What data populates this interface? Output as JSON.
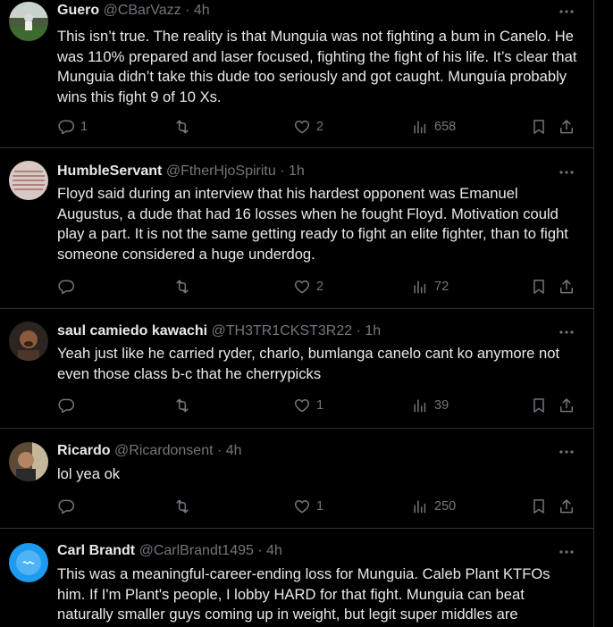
{
  "tweets": [
    {
      "name": "Guero",
      "handle": "@CBarVazz",
      "time": "4h",
      "text": "This isn’t true. The reality is that Munguia was not fighting a bum in Canelo. He was 110% prepared and laser focused, fighting the fight of his life. It’s clear that Munguia didn’t take this dude too seriously and got caught. Munguía probably wins this fight 9 of 10 Xs.",
      "replies": "1",
      "reposts": "",
      "likes": "2",
      "views": "658"
    },
    {
      "name": "HumbleServant",
      "handle": "@FtherHjoSpiritu",
      "time": "1h",
      "text": "Floyd said during an interview that his hardest opponent was Emanuel Augustus, a dude that had 16 losses when he fought Floyd. Motivation could play a part. It is not the same getting ready to fight an elite fighter, than to fight someone considered a huge underdog.",
      "replies": "",
      "reposts": "",
      "likes": "2",
      "views": "72"
    },
    {
      "name": "saul camiedo kawachi",
      "handle": "@TH3TR1CKST3R22",
      "time": "1h",
      "text": "Yeah just like he carried ryder, charlo, bumlanga canelo cant ko anymore not even those class b-c that he cherrypicks",
      "replies": "",
      "reposts": "",
      "likes": "1",
      "views": "39"
    },
    {
      "name": "Ricardo",
      "handle": "@Ricardonsent",
      "time": "4h",
      "text": "lol yea ok",
      "replies": "",
      "reposts": "",
      "likes": "1",
      "views": "250"
    },
    {
      "name": "Carl Brandt",
      "handle": "@CarlBrandt1495",
      "time": "4h",
      "text": "This was a meaningful-career-ending loss for Munguia. Caleb Plant KTFOs him. If I'm Plant's people, I lobby HARD for that fight. Munguia can beat naturally smaller guys coming up in weight, but legit super middles are",
      "replies": "",
      "reposts": "",
      "likes": "",
      "views": ""
    }
  ],
  "separator": "·",
  "icons": [
    "more-icon",
    "reply-icon",
    "repost-icon",
    "like-icon",
    "views-icon",
    "bookmark-icon",
    "share-icon"
  ],
  "colors": {
    "background": "#000000",
    "text": "#e7e9ea",
    "muted": "#71767b",
    "border": "#2f3336"
  }
}
